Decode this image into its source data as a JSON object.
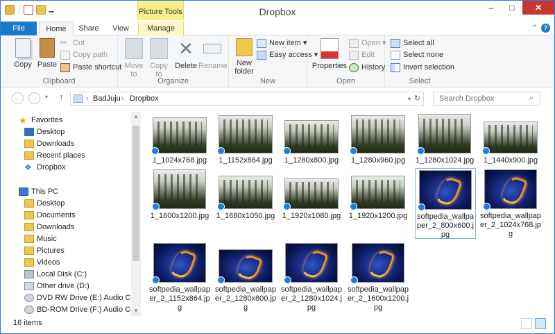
{
  "window": {
    "title": "Dropbox",
    "context_tab_group": "Picture Tools",
    "controls": {
      "minimize": "–",
      "maximize": "□",
      "close": "✕"
    }
  },
  "ribbon_tabs": [
    {
      "label": "File"
    },
    {
      "label": "Home"
    },
    {
      "label": "Share"
    },
    {
      "label": "View"
    },
    {
      "label": "Manage"
    }
  ],
  "help": {
    "chevron": "⌃",
    "q": "?"
  },
  "ribbon": {
    "clipboard": {
      "label": "Clipboard",
      "copy": "Copy",
      "paste": "Paste",
      "cut": "Cut",
      "copy_path": "Copy path",
      "paste_shortcut": "Paste shortcut"
    },
    "organize": {
      "label": "Organize",
      "move_to": "Move",
      "move_to_2": "to",
      "copy_to": "Copy",
      "copy_to_2": "to",
      "delete": "Delete",
      "rename": "Rename"
    },
    "new": {
      "label": "New",
      "new_folder": "New",
      "new_folder_2": "folder",
      "new_item": "New item",
      "easy_access": "Easy access"
    },
    "open": {
      "label": "Open",
      "properties": "Properties",
      "open": "Open",
      "edit": "Edit",
      "history": "History"
    },
    "select": {
      "label": "Select",
      "select_all": "Select all",
      "select_none": "Select none",
      "invert_selection": "Invert selection"
    }
  },
  "address": {
    "crumbs": [
      "BadJuju",
      "Dropbox"
    ],
    "search_placeholder": "Search Dropbox"
  },
  "nav": {
    "favorites_label": "Favorites",
    "favorites": [
      "Desktop",
      "Downloads",
      "Recent places",
      "Dropbox"
    ],
    "thispc_label": "This PC",
    "thispc": [
      "Desktop",
      "Documents",
      "Downloads",
      "Music",
      "Pictures",
      "Videos",
      "Local Disk (C:)",
      "Other drive (D:)",
      "DVD RW Drive (E:) Audio CD",
      "BD-ROM Drive (F:) Audio CD"
    ]
  },
  "files": [
    {
      "name": "1_1024x768.jpg",
      "kind": "forest"
    },
    {
      "name": "1_1152x864.jpg",
      "kind": "forest"
    },
    {
      "name": "1_1280x800.jpg",
      "kind": "forest"
    },
    {
      "name": "1_1280x960.jpg",
      "kind": "forest"
    },
    {
      "name": "1_1280x1024.jpg",
      "kind": "forest"
    },
    {
      "name": "1_1440x900.jpg",
      "kind": "forest"
    },
    {
      "name": "1_1600x1200.jpg",
      "kind": "forest"
    },
    {
      "name": "1_1680x1050.jpg",
      "kind": "forest"
    },
    {
      "name": "1_1920x1080.jpg",
      "kind": "forest"
    },
    {
      "name": "1_1920x1200.jpg",
      "kind": "forest"
    },
    {
      "name": "softpedia_wallpaper_2_800x600.jpg",
      "kind": "space",
      "selected": true
    },
    {
      "name": "softpedia_wallpaper_2_1024x768.jpg",
      "kind": "space"
    },
    {
      "name": "softpedia_wallpaper_2_1152x864.jpg",
      "kind": "space"
    },
    {
      "name": "softpedia_wallpaper_2_1280x800.jpg",
      "kind": "space"
    },
    {
      "name": "softpedia_wallpaper_2_1280x1024.jpg",
      "kind": "space"
    },
    {
      "name": "softpedia_wallpaper_2_1600x1200.jpg",
      "kind": "space"
    }
  ],
  "status": {
    "item_count": "16 items"
  },
  "colors": {
    "accent": "#1979ca",
    "context_tab": "#f7ef8a",
    "close": "#c7372f"
  }
}
